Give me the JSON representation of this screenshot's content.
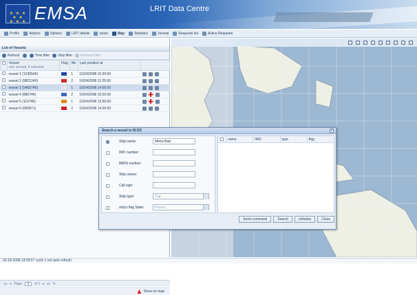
{
  "banner": {
    "brand": "EMSA",
    "app_title": "LRIT Data Centre"
  },
  "menu": [
    {
      "label": "Profile",
      "icon": "user-icon"
    },
    {
      "label": "Actions",
      "icon": "gear-icon"
    },
    {
      "label": "Options",
      "icon": "wrench-icon"
    },
    {
      "label": "LRIT details",
      "icon": "info-icon"
    },
    {
      "label": "views",
      "icon": "eye-icon"
    },
    {
      "label": "Map",
      "icon": "map-icon",
      "active": true
    },
    {
      "label": "Statistics",
      "icon": "chart-icon"
    },
    {
      "label": "Journal",
      "icon": "journal-icon"
    },
    {
      "label": "Requests list",
      "icon": "list-icon"
    },
    {
      "label": "Active Requests",
      "icon": "active-icon"
    }
  ],
  "panel": {
    "title": "List of Vessels",
    "toolbar": {
      "refresh": "Refresh",
      "time_filter": "Time filter",
      "ship_filter": "Ship filter",
      "remove_filter": "Remove filter"
    },
    "columns": {
      "vessel": "Vessel",
      "vessel_sub": "red: arrived, if selected",
      "flag": "Flag",
      "nb": "Nb",
      "last_position": "Last position at"
    },
    "rows": [
      {
        "name": "vessel 1 (1235546)",
        "flag_color": "#1f4aa8",
        "nb": "1",
        "time": "10/24/2008 15:30:00",
        "selected": false
      },
      {
        "name": "vessel 2 (9821240)",
        "flag_color": "#d42a2a",
        "nb": "2",
        "time": "10/24/2008 11:25:00",
        "selected": false
      },
      {
        "name": "vessel 3 (5465746)",
        "flag_color": "#e5e5e5",
        "nb": "1",
        "time": "10/24/2008 14:00:00",
        "selected": true
      },
      {
        "name": "vessel 4 (880746)",
        "flag_color": "#3a68c0",
        "nb": "2",
        "time": "10/24/2008 15:02:00",
        "selected": false
      },
      {
        "name": "vessel 5 (115746)",
        "flag_color": "#e08a1a",
        "nb": "1",
        "time": "10/24/2008 12:50:00",
        "selected": false
      },
      {
        "name": "vessel 6 (050871)",
        "flag_color": "#c8242a",
        "nb": "2",
        "time": "10/24/2008 14:35:00",
        "selected": false
      }
    ],
    "pager": {
      "page_label": "Page",
      "page_value": "1",
      "of_label": "of 1"
    },
    "show_on_map": "Show on map"
  },
  "dialog": {
    "title": "Search a vessel in DI DC",
    "fields": [
      {
        "label": "Ship name:",
        "value": "Metra Bad",
        "checked": true
      },
      {
        "label": "IMO number:",
        "value": ""
      },
      {
        "label": "MMSI number:",
        "value": ""
      },
      {
        "label": "Ship owner:",
        "value": ""
      },
      {
        "label": "Call sign:",
        "value": ""
      },
      {
        "label": "Ship type:",
        "value": "Tug",
        "select": true
      },
      {
        "label": "ship's flag State:",
        "value": "France",
        "select": true
      }
    ],
    "result_columns": [
      "name",
      "IMO",
      "type",
      "flag"
    ],
    "buttons": {
      "send": "Send command",
      "search": "Search",
      "initialise": "Initialise",
      "close": "Close"
    }
  },
  "status": "02-18-2008 14:09:57  cycle 1 not auto refresh"
}
